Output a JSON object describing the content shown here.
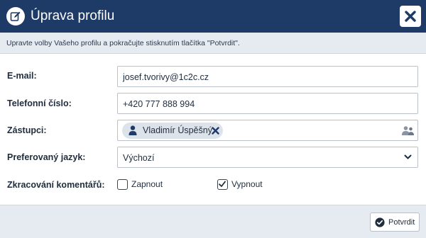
{
  "header": {
    "title": "Úprava profilu",
    "edit_icon": "edit-profile-icon",
    "close_icon": "close-icon"
  },
  "info": {
    "text": "Upravte volby Vašeho profilu a pokračujte stisknutím tlačítka \"Potvrdit\"."
  },
  "form": {
    "email": {
      "label": "E-mail:",
      "value": "josef.tvorivy@1c2c.cz"
    },
    "phone": {
      "label": "Telefonní číslo:",
      "value": "+420 777 888 994"
    },
    "substitutes": {
      "label": "Zástupci:",
      "chips": [
        {
          "name": "Vladimír Úspěšný"
        }
      ],
      "picker_icon": "user-group-icon"
    },
    "language": {
      "label": "Preferovaný jazyk:",
      "selected": "Výchozí"
    },
    "comment_shortening": {
      "label": "Zkracování komentářů:",
      "options": [
        {
          "label": "Zapnout",
          "checked": false
        },
        {
          "label": "Vypnout",
          "checked": true
        }
      ]
    }
  },
  "footer": {
    "confirm_label": "Potvrdit"
  },
  "colors": {
    "header_bg": "#1e3a66",
    "panel_bg": "#e6eaf1",
    "chip_bg": "#dde3ea"
  }
}
